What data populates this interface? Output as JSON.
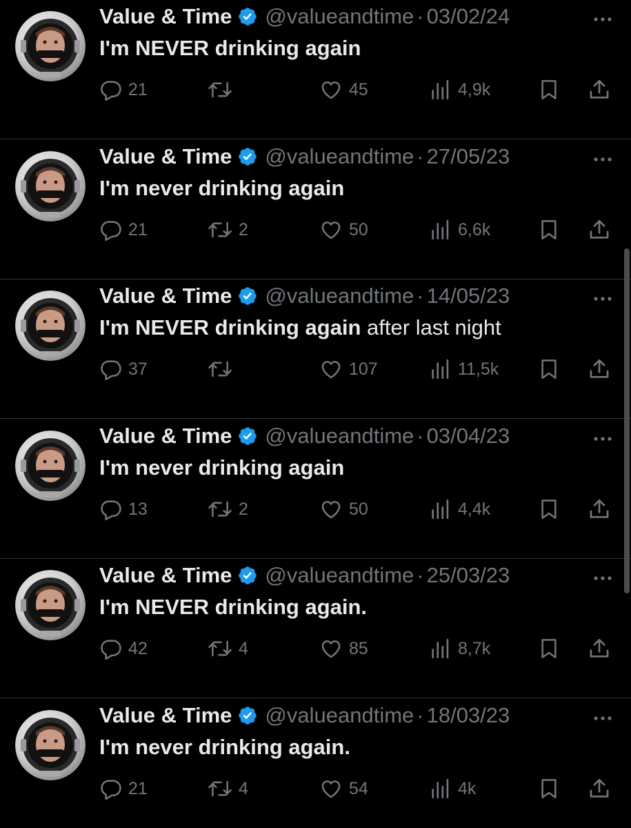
{
  "tweets": [
    {
      "name": "Value & Time",
      "handle": "@valueandtime",
      "separator": "·",
      "date": "03/02/24",
      "text_bold": "I'm NEVER drinking again",
      "text_regular": "",
      "replies": "21",
      "retweets": "",
      "likes": "45",
      "views": "4,9k"
    },
    {
      "name": "Value & Time",
      "handle": "@valueandtime",
      "separator": "·",
      "date": "27/05/23",
      "text_bold": "I'm never drinking again",
      "text_regular": "",
      "replies": "21",
      "retweets": "2",
      "likes": "50",
      "views": "6,6k"
    },
    {
      "name": "Value & Time",
      "handle": "@valueandtime",
      "separator": "·",
      "date": "14/05/23",
      "text_bold": "I'm NEVER drinking again",
      "text_regular": " after last night",
      "replies": "37",
      "retweets": "",
      "likes": "107",
      "views": "11,5k"
    },
    {
      "name": "Value & Time",
      "handle": "@valueandtime",
      "separator": "·",
      "date": "03/04/23",
      "text_bold": "I'm never drinking again",
      "text_regular": "",
      "replies": "13",
      "retweets": "2",
      "likes": "50",
      "views": "4,4k"
    },
    {
      "name": "Value & Time",
      "handle": "@valueandtime",
      "separator": "·",
      "date": "25/03/23",
      "text_bold": "I'm NEVER drinking again.",
      "text_regular": "",
      "replies": "42",
      "retweets": "4",
      "likes": "85",
      "views": "8,7k"
    },
    {
      "name": "Value & Time",
      "handle": "@valueandtime",
      "separator": "·",
      "date": "18/03/23",
      "text_bold": "I'm never drinking again.",
      "text_regular": "",
      "replies": "21",
      "retweets": "4",
      "likes": "54",
      "views": "4k"
    }
  ],
  "icons": {
    "verified": "verified-badge-icon",
    "more": "more-options-icon",
    "reply": "reply-icon",
    "retweet": "retweet-icon",
    "like": "heart-icon",
    "views": "views-chart-icon",
    "bookmark": "bookmark-icon",
    "share": "share-icon"
  },
  "colors": {
    "background": "#000000",
    "primary_text": "#e7e9ea",
    "secondary_text": "#71767b",
    "verified_blue": "#1d9bf0",
    "divider": "#2f3336"
  }
}
